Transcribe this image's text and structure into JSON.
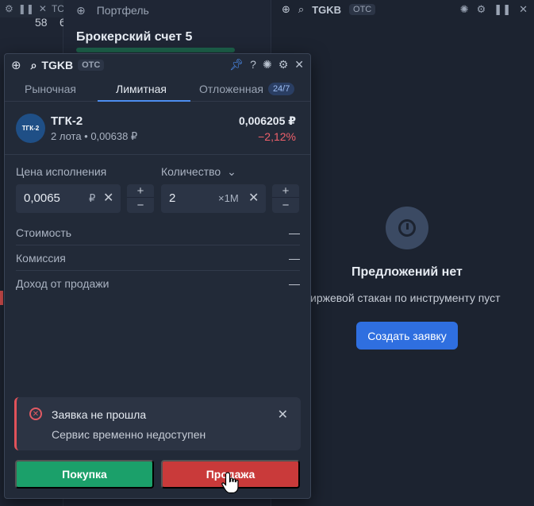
{
  "background": {
    "left_panel": {
      "value_1": "58",
      "value_2": "6",
      "header_fragment": "ТС"
    },
    "portfolio": {
      "tab_label": "Портфель",
      "title": "Брокерский счет 5"
    },
    "orderbook": {
      "ticker": "TGKB",
      "market_tag": "OTC",
      "empty_title": "Предложений нет",
      "empty_subtitle": "иржевой стакан по инструменту пуст",
      "create_button": "Создать заявку"
    }
  },
  "order_window": {
    "ticker": "TGKB",
    "market_tag": "OTC",
    "tabs": [
      {
        "label": "Рыночная",
        "active": false
      },
      {
        "label": "Лимитная",
        "active": true
      },
      {
        "label": "Отложенная",
        "active": false,
        "badge": "24/7"
      }
    ],
    "instrument": {
      "logo_text": "ТГК-2",
      "name": "ТГК-2",
      "subtitle": "2 лота • 0,00638 ₽",
      "price": "0,006205 ₽",
      "change": "−2,12%"
    },
    "price_field": {
      "label": "Цена исполнения",
      "value": "0,0065",
      "unit": "₽"
    },
    "quantity_field": {
      "label": "Количество",
      "value": "2",
      "unit": "×1M"
    },
    "summary": [
      {
        "label": "Стоимость",
        "value": "—"
      },
      {
        "label": "Комиссия",
        "value": "—"
      },
      {
        "label": "Доход от продажи",
        "value": "—"
      }
    ],
    "alert": {
      "title": "Заявка не прошла",
      "text": "Сервис временно недоступен"
    },
    "buy_button": "Покупка",
    "sell_button": "Продажа"
  },
  "colors": {
    "accent": "#4d8ef0",
    "buy": "#1ba06a",
    "sell": "#c93a3a",
    "negative": "#f0606b",
    "create_button": "#2f6fe0"
  }
}
